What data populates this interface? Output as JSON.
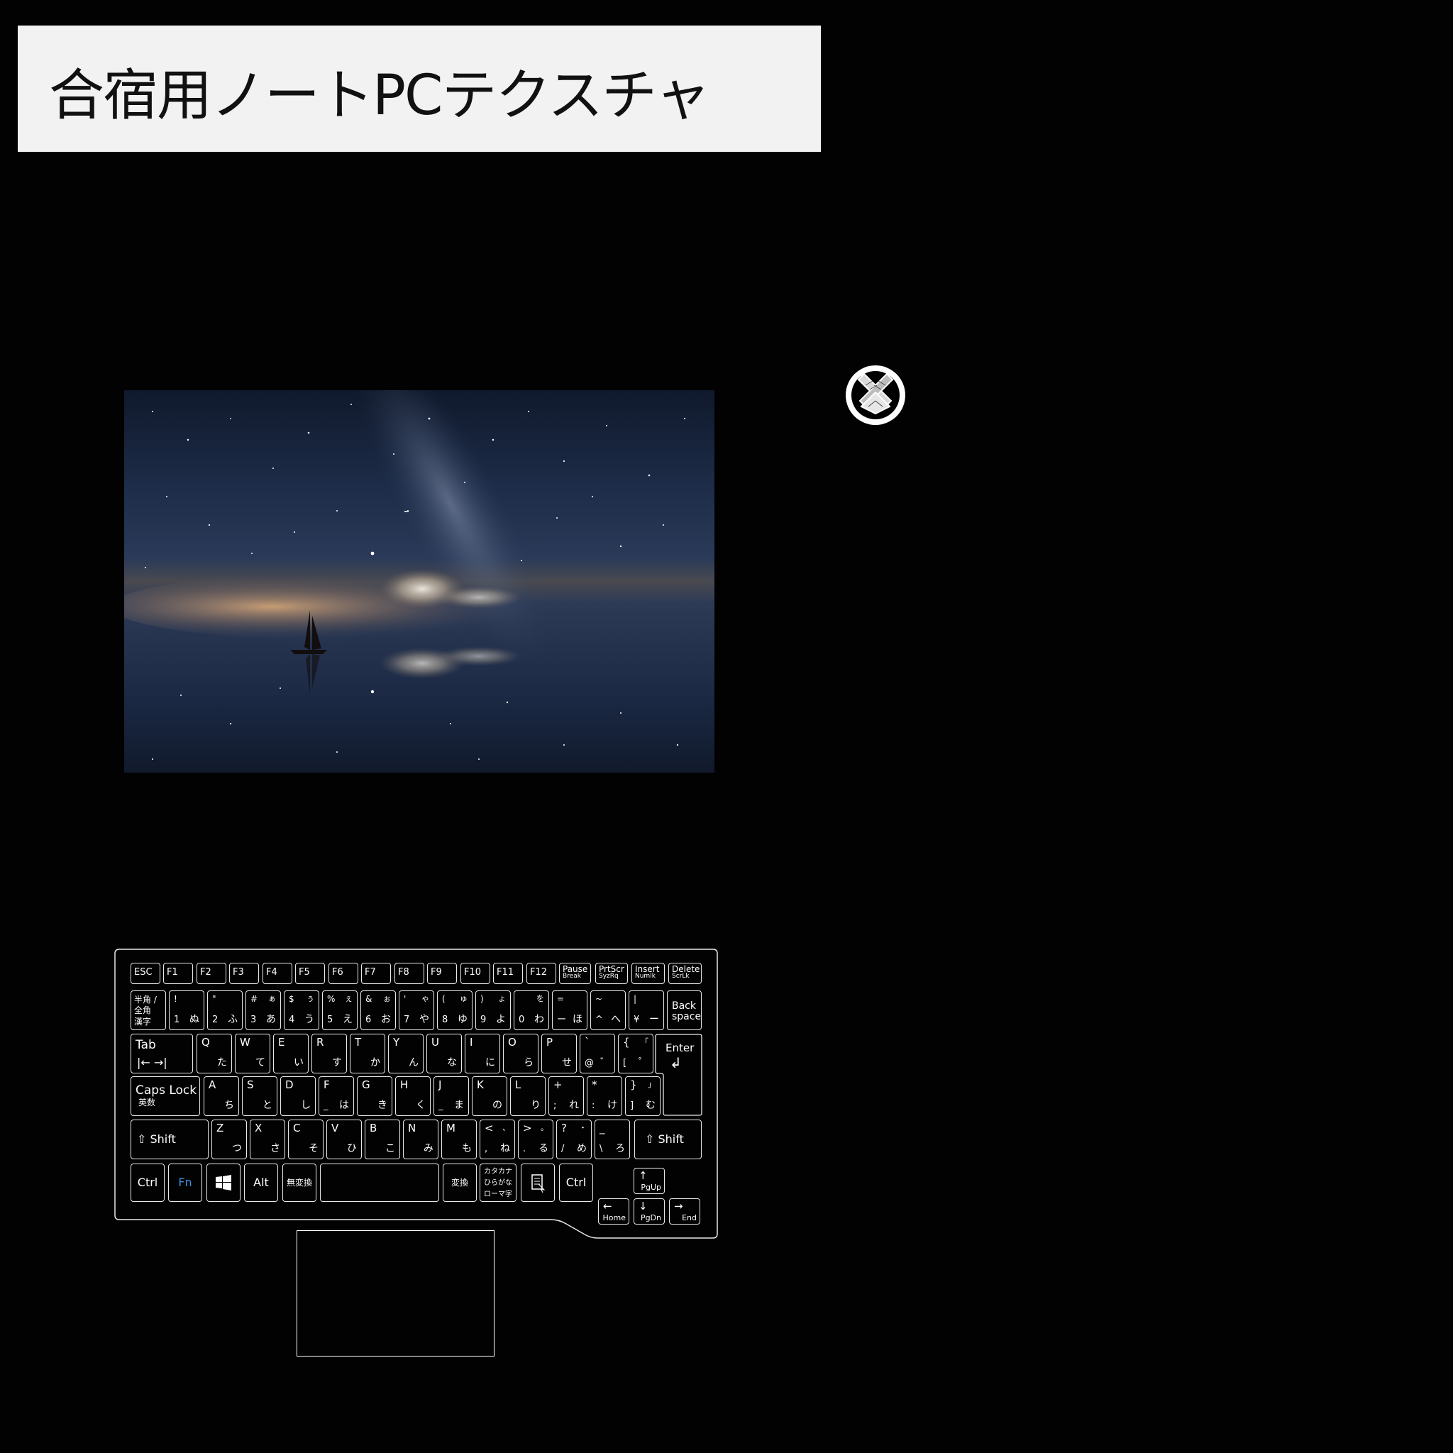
{
  "title": "合宿用ノートPCテクスチャ",
  "colors": {
    "background": "#020202",
    "title_bg": "#f2f2f2",
    "fn_key": "#3b8ee0",
    "key_outline": "#e8e8e8"
  },
  "wallpaper": {
    "icon": "starry-night-sailboat-image"
  },
  "logo": {
    "icon": "crossed-feathers-crest-icon"
  },
  "touchpad": {
    "icon": "touchpad"
  },
  "keyboard": {
    "fn_row": [
      {
        "t": "ESC"
      },
      {
        "t": "F1"
      },
      {
        "t": "F2"
      },
      {
        "t": "F3"
      },
      {
        "t": "F4"
      },
      {
        "t": "F5"
      },
      {
        "t": "F6"
      },
      {
        "t": "F7"
      },
      {
        "t": "F8"
      },
      {
        "t": "F9"
      },
      {
        "t": "F10"
      },
      {
        "t": "F11"
      },
      {
        "t": "F12"
      },
      {
        "t": "Pause",
        "s": "Break"
      },
      {
        "t": "PrtScr",
        "s": "SyzRq"
      },
      {
        "t": "Insert",
        "s": "Numlk"
      },
      {
        "t": "Delete",
        "s": "ScrLk"
      }
    ],
    "num_row": {
      "hankaku": {
        "a": "半角 /",
        "b": "全角",
        "c": "漢字"
      },
      "keys": [
        {
          "tl": "!",
          "tr": "",
          "bl": "1",
          "br": "ぬ"
        },
        {
          "tl": "\"",
          "tr": "",
          "bl": "2",
          "br": "ふ"
        },
        {
          "tl": "#",
          "tr": "ぁ",
          "bl": "3",
          "br": "あ"
        },
        {
          "tl": "$",
          "tr": "ぅ",
          "bl": "4",
          "br": "う"
        },
        {
          "tl": "%",
          "tr": "ぇ",
          "bl": "5",
          "br": "え"
        },
        {
          "tl": "&",
          "tr": "ぉ",
          "bl": "6",
          "br": "お"
        },
        {
          "tl": "'",
          "tr": "ゃ",
          "bl": "7",
          "br": "や"
        },
        {
          "tl": "(",
          "tr": "ゅ",
          "bl": "8",
          "br": "ゆ"
        },
        {
          "tl": ")",
          "tr": "ょ",
          "bl": "9",
          "br": "よ"
        },
        {
          "tl": "",
          "tr": "を",
          "bl": "0",
          "br": "わ"
        },
        {
          "tl": "=",
          "tr": "",
          "bl": "ー",
          "br": "ほ"
        },
        {
          "tl": "~",
          "tr": "",
          "bl": "^",
          "br": "へ"
        },
        {
          "tl": "|",
          "tr": "",
          "bl": "¥",
          "br": "ー"
        }
      ],
      "backspace": {
        "a": "Back",
        "b": "space"
      }
    },
    "q_row": {
      "tab": "Tab",
      "keys": [
        {
          "tl": "Q",
          "br": "た"
        },
        {
          "tl": "W",
          "br": "て"
        },
        {
          "tl": "E",
          "br": "い"
        },
        {
          "tl": "R",
          "br": "す"
        },
        {
          "tl": "T",
          "br": "か"
        },
        {
          "tl": "Y",
          "br": "ん"
        },
        {
          "tl": "U",
          "br": "な"
        },
        {
          "tl": "I",
          "br": "に"
        },
        {
          "tl": "O",
          "br": "ら"
        },
        {
          "tl": "P",
          "br": "せ"
        },
        {
          "tl": "`",
          "bl": "@",
          "br": "゛"
        },
        {
          "tl": "{",
          "tr": "「",
          "bl": "[",
          "br": "゜"
        }
      ],
      "enter": "Enter"
    },
    "a_row": {
      "caps": {
        "a": "Caps Lock",
        "b": "英数"
      },
      "keys": [
        {
          "tl": "A",
          "br": "ち"
        },
        {
          "tl": "S",
          "br": "と"
        },
        {
          "tl": "D",
          "br": "し"
        },
        {
          "tl": "F",
          "bl": "_",
          "br": "は"
        },
        {
          "tl": "G",
          "br": "き"
        },
        {
          "tl": "H",
          "br": "く"
        },
        {
          "tl": "J",
          "bl": "_",
          "br": "ま"
        },
        {
          "tl": "K",
          "br": "の"
        },
        {
          "tl": "L",
          "br": "り"
        },
        {
          "tl": "+",
          "bl": ";",
          "br": "れ"
        },
        {
          "tl": "*",
          "bl": ":",
          "br": "け"
        },
        {
          "tl": "}",
          "tr": "」",
          "bl": "]",
          "br": "む"
        }
      ]
    },
    "z_row": {
      "lshift": "Shift",
      "keys": [
        {
          "tl": "Z",
          "br": "つ"
        },
        {
          "tl": "X",
          "br": "さ"
        },
        {
          "tl": "C",
          "br": "そ"
        },
        {
          "tl": "V",
          "br": "ひ"
        },
        {
          "tl": "B",
          "br": "こ"
        },
        {
          "tl": "N",
          "br": "み"
        },
        {
          "tl": "M",
          "br": "も"
        },
        {
          "tl": "<",
          "tr": "、",
          "bl": ",",
          "br": "ね"
        },
        {
          "tl": ">",
          "tr": "。",
          "bl": ".",
          "br": "る"
        },
        {
          "tl": "?",
          "tr": "・",
          "bl": "/",
          "br": "め"
        },
        {
          "tl": "_",
          "bl": "\\",
          "br": "ろ"
        }
      ],
      "rshift": "Shift"
    },
    "bottom_row": {
      "ctrl": "Ctrl",
      "fn": "Fn",
      "win_icon": "windows-logo-icon",
      "alt": "Alt",
      "muhenkan": "無変換",
      "henkan": "変換",
      "kana": {
        "a": "カタカナ",
        "b": "ひらがな",
        "c": "ローマ字"
      },
      "menu_icon": "application-menu-icon",
      "rctrl": "Ctrl"
    },
    "arrows": {
      "up": "PgUp",
      "left": "Home",
      "down": "PgDn",
      "right": "End"
    }
  }
}
